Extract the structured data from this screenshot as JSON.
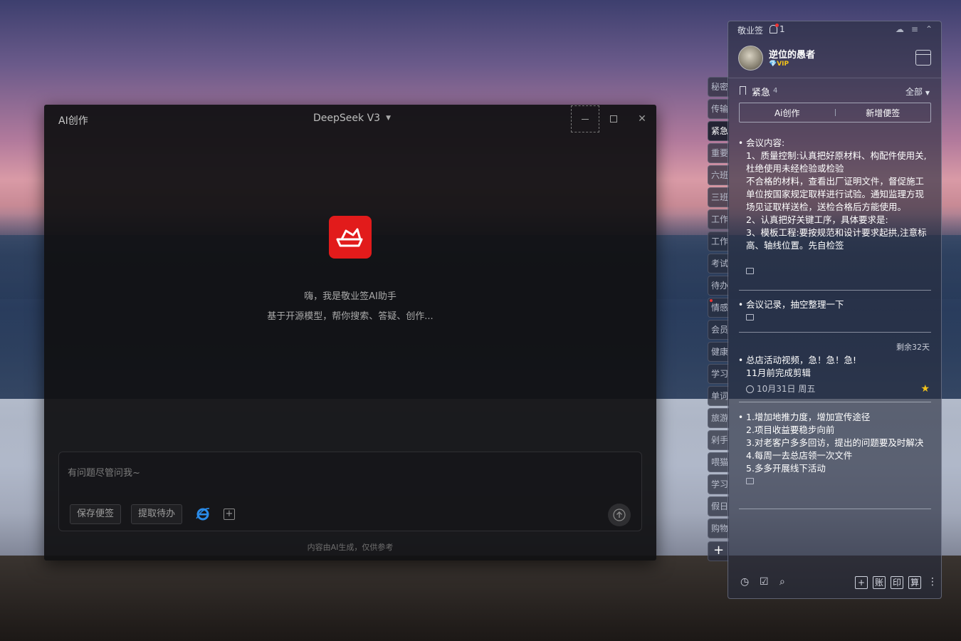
{
  "ai_window": {
    "title": "AI创作",
    "model": "DeepSeek V3",
    "greeting_line1": "嗨，我是敬业签AI助手",
    "greeting_line2": "基于开源模型，帮你搜索、答疑、创作...",
    "input_placeholder": "有问题尽管问我~",
    "save_label": "保存便签",
    "extract_label": "提取待办",
    "disclaimer": "内容由AI生成，仅供参考",
    "brand_color": "#e21b1b"
  },
  "side_tabs": [
    {
      "label": "秘密"
    },
    {
      "label": "传输"
    },
    {
      "label": "紧急"
    },
    {
      "label": "重要"
    },
    {
      "label": "六班"
    },
    {
      "label": "三班"
    },
    {
      "label": "工作"
    },
    {
      "label": "工作"
    },
    {
      "label": "考试"
    },
    {
      "label": "待办"
    },
    {
      "label": "情感"
    },
    {
      "label": "会员"
    },
    {
      "label": "健康"
    },
    {
      "label": "学习"
    },
    {
      "label": "单词"
    },
    {
      "label": "旅游"
    },
    {
      "label": "剁手"
    },
    {
      "label": "喂猫"
    },
    {
      "label": "学习"
    },
    {
      "label": "假日"
    },
    {
      "label": "购物"
    }
  ],
  "panel": {
    "app_name": "敬业签",
    "notification_count": "1",
    "user": {
      "name": "逆位的愚者",
      "badge": "VIP"
    },
    "category": {
      "name": "紧急",
      "count": "4"
    },
    "filter": "全部",
    "ai_button": "Ai创作",
    "new_note_button": "新增便签",
    "remaining": "剩余32天",
    "notes": [
      {
        "lines": [
          "会议内容:",
          "1、质量控制:认真把好原材料、构配件使用关,杜绝使用未经检验或检验",
          "不合格的材料，查看出厂证明文件，督促施工单位按国家规定取样进行试验。通知监理方现场见证取样送检，送检合格后方能使用。",
          "2、认真把好关键工序，具体要求是:",
          "3、模板工程:要按规范和设计要求起拱,注意标高、轴线位置。先自检签"
        ]
      },
      {
        "lines": [
          "会议记录，抽空整理一下"
        ]
      },
      {
        "lines": [
          "总店活动视频，急！急！急!",
          "11月前完成剪辑"
        ],
        "date": "10月31日 周五"
      },
      {
        "lines": [
          "1.增加地推力度，增加宣传途径",
          "2.项目收益要稳步向前",
          "3.对老客户多多回访，提出的问题要及时解决",
          "4.每周一去总店领一次文件",
          "5.多多开展线下活动"
        ]
      }
    ],
    "bottom_boxes": [
      "+",
      "账",
      "印",
      "算"
    ]
  }
}
